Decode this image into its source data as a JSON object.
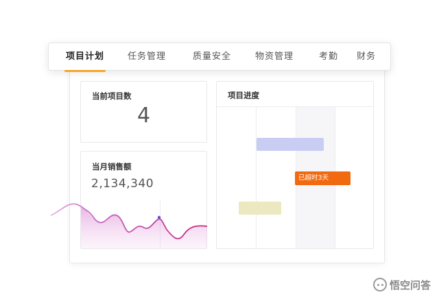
{
  "tabs": [
    {
      "label": "项目计划",
      "active": true
    },
    {
      "label": "任务管理",
      "active": false
    },
    {
      "label": "质量安全",
      "active": false
    },
    {
      "label": "物资管理",
      "active": false
    },
    {
      "label": "考勤",
      "active": false
    },
    {
      "label": "财务",
      "active": false
    }
  ],
  "project_count": {
    "title": "当前项目数",
    "value": "4"
  },
  "monthly_sales": {
    "title": "当月销售额",
    "value": "2,134,340"
  },
  "progress": {
    "title": "项目进度",
    "overdue_label": "已超时3天"
  },
  "watermark": {
    "text": "悟空问答"
  },
  "colors": {
    "accent": "#f5a623",
    "overdue": "#f26a10",
    "bar_blue": "#c9cdf4",
    "bar_yellow": "#ece8bf",
    "sparkline": "#c2247a"
  }
}
